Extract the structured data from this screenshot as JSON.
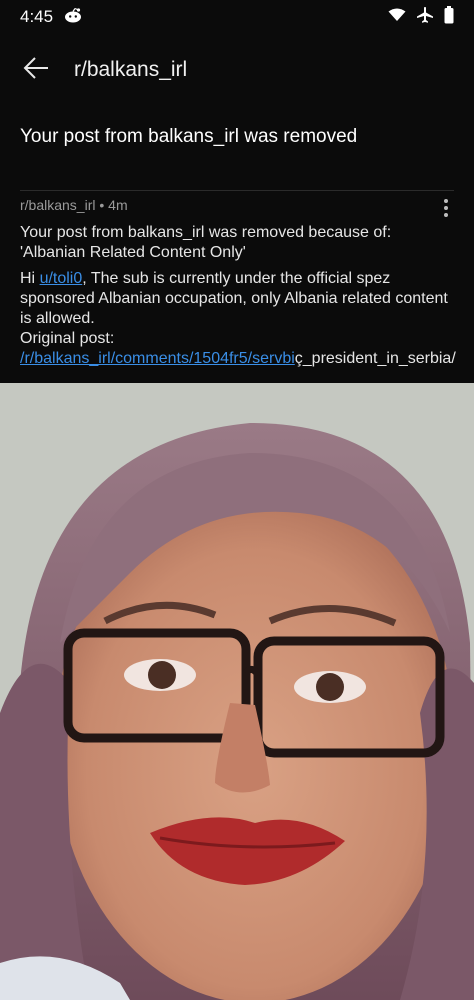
{
  "status_bar": {
    "time": "4:45"
  },
  "header": {
    "title": "r/balkans_irl"
  },
  "page_title": "Your post from balkans_irl was removed",
  "message": {
    "meta": "r/balkans_irl • 4m",
    "reason_text": "Your post from balkans_irl was removed because of: 'Albanian Related Content Only'",
    "body_prefix": "Hi ",
    "user_link": "u/toli0",
    "body_after_user": ", The sub is currently under the official spez sponsored Albanian occupation, only Albania related content is allowed.",
    "original_post_label": "Original post: ",
    "post_link": "/r/balkans_irl/comments/1504fr5/servbi",
    "post_link_tail": "ç_president_in_serbia/"
  },
  "icons": {
    "back": "arrow-left-icon",
    "more": "more-vertical-icon",
    "wifi": "wifi-icon",
    "airplane": "airplane-icon",
    "battery": "battery-icon",
    "notification": "reddit-icon"
  },
  "colors": {
    "background": "#0b0b0b",
    "link": "#3a8ee6",
    "meta_text": "#9a9a9a"
  }
}
